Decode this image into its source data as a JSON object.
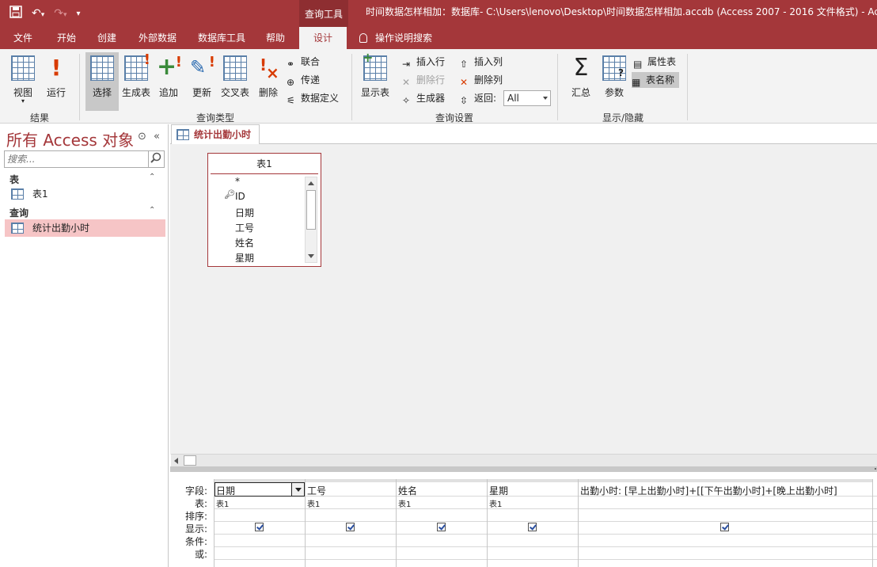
{
  "window": {
    "title": "时间数据怎样相加：数据库- C:\\Users\\lenovo\\Desktop\\时间数据怎样相加.accdb (Access 2007 - 2016 文件格式) - Ac",
    "context_tab": "查询工具"
  },
  "qat": {
    "save_icon": "save-icon",
    "undo_icon": "undo-icon",
    "redo_icon": "redo-icon",
    "more": "▾"
  },
  "tabs": [
    "文件",
    "开始",
    "创建",
    "外部数据",
    "数据库工具",
    "帮助",
    "设计"
  ],
  "tell_me": "操作说明搜索",
  "ribbon": {
    "results": {
      "label": "结果",
      "view": "视图",
      "run": "运行"
    },
    "query_type": {
      "label": "查询类型",
      "select": "选择",
      "make_table": "生成表",
      "append": "追加",
      "update": "更新",
      "crosstab": "交叉表",
      "delete": "删除",
      "union": "联合",
      "passthrough": "传递",
      "data_definition": "数据定义"
    },
    "query_setup": {
      "label": "查询设置",
      "show_table": "显示表",
      "insert_rows": "插入行",
      "delete_rows": "删除行",
      "builder": "生成器",
      "insert_columns": "插入列",
      "delete_columns": "删除列",
      "return_label": "返回:",
      "return_value": "All"
    },
    "show_hide": {
      "label": "显示/隐藏",
      "totals": "汇总",
      "parameters": "参数",
      "property_sheet": "属性表",
      "table_names": "表名称"
    }
  },
  "nav": {
    "title": "所有 Access 对象",
    "search_placeholder": "搜索...",
    "groups": [
      {
        "name": "表",
        "items": [
          "表1"
        ]
      },
      {
        "name": "查询",
        "items": [
          "统计出勤小时"
        ]
      }
    ]
  },
  "document": {
    "tab": "统计出勤小时",
    "table_box": {
      "name": "表1",
      "fields": [
        "*",
        "ID",
        "日期",
        "工号",
        "姓名",
        "星期"
      ]
    }
  },
  "grid": {
    "row_labels": [
      "字段:",
      "表:",
      "排序:",
      "显示:",
      "条件:",
      "或:"
    ],
    "columns": [
      {
        "field": "日期",
        "table": "表1",
        "show": true
      },
      {
        "field": "工号",
        "table": "表1",
        "show": true
      },
      {
        "field": "姓名",
        "table": "表1",
        "show": true
      },
      {
        "field": "星期",
        "table": "表1",
        "show": true
      },
      {
        "field": "出勤小时: [早上出勤小时]+[[下午出勤小时]+[晚上出勤小时]",
        "table": "",
        "show": true
      }
    ]
  }
}
